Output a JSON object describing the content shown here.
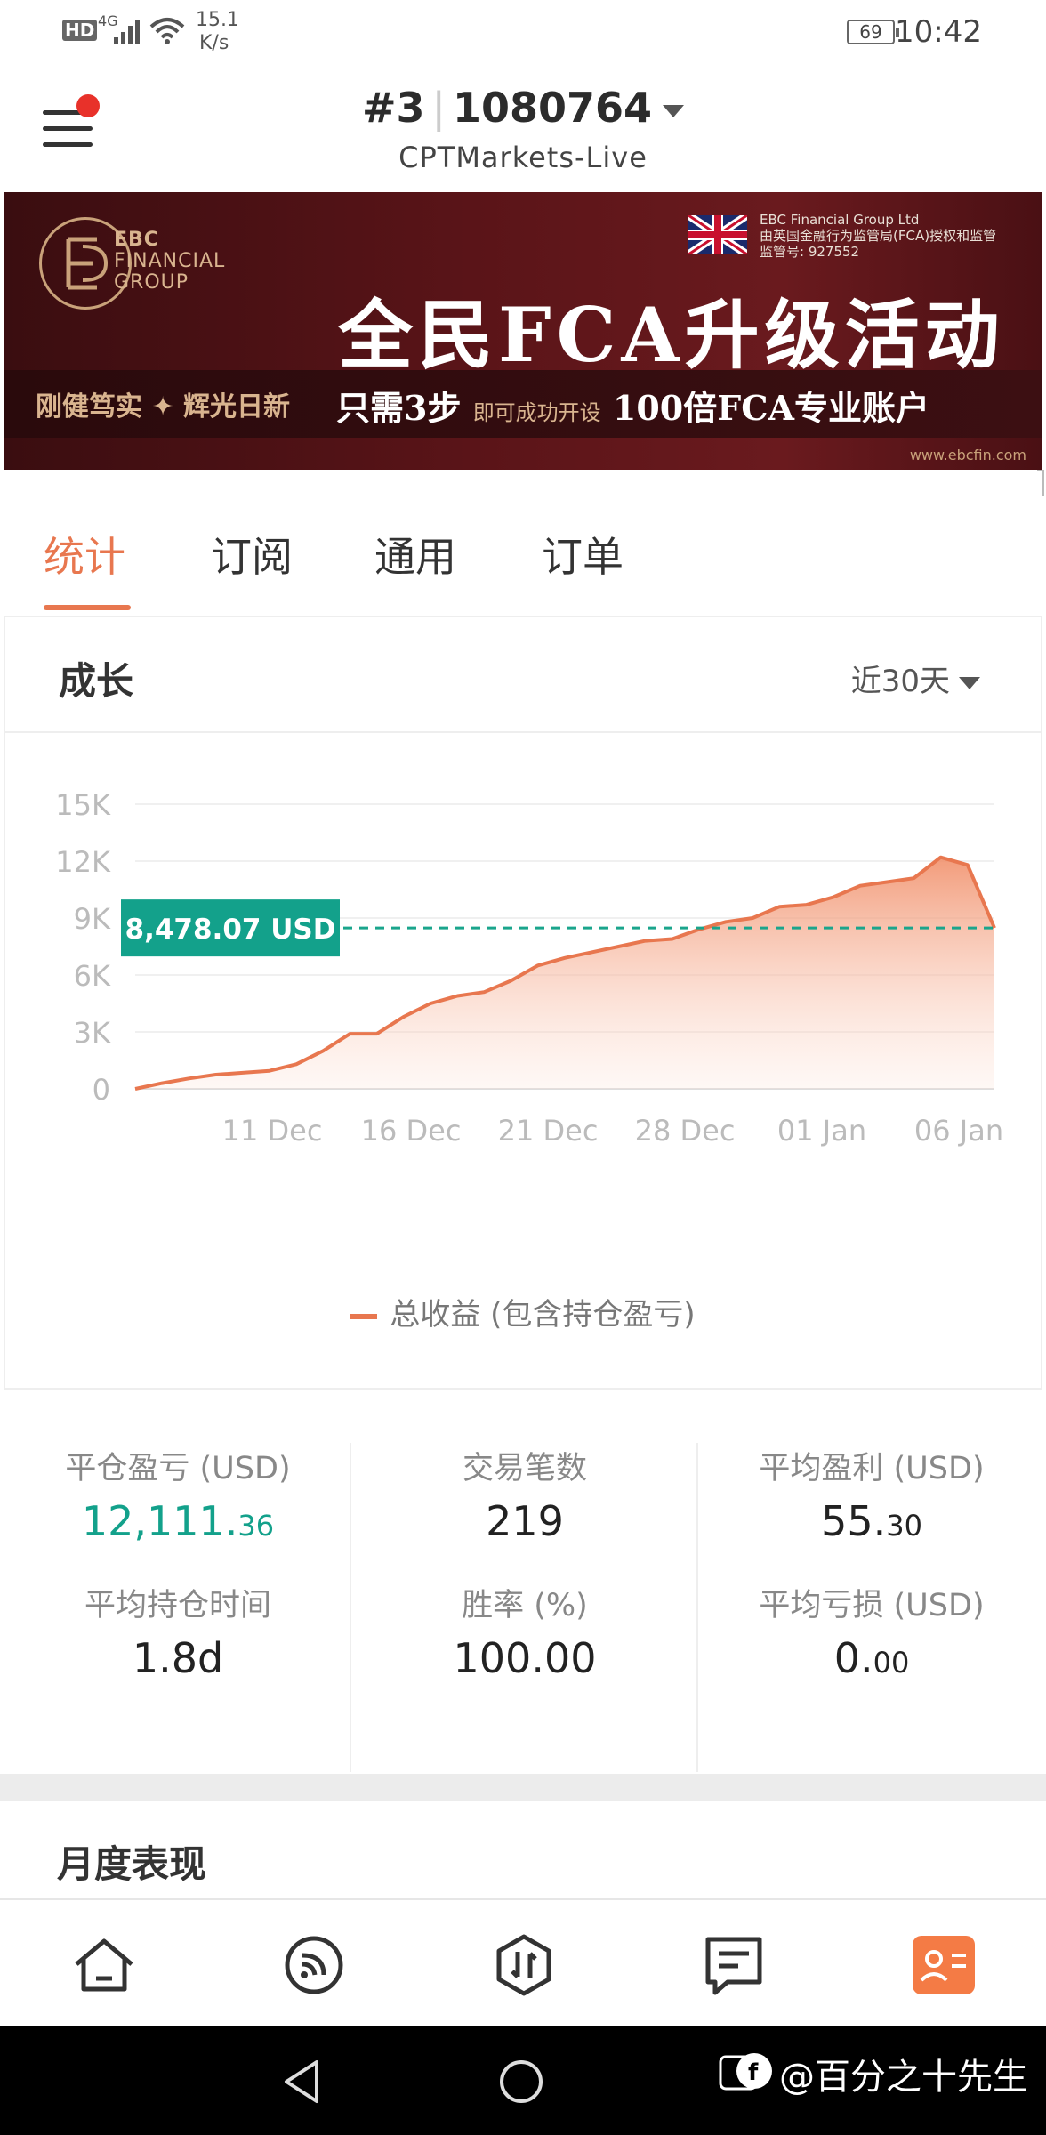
{
  "status_bar": {
    "network": "HD",
    "signal": "4G",
    "speed_value": "15.1",
    "speed_unit": "K/s",
    "battery": "69",
    "time": "10:42"
  },
  "header": {
    "account_index": "#3",
    "account_number": "1080764",
    "server": "CPTMarkets-Live"
  },
  "banner": {
    "company_lines": [
      "EBC",
      "FINANCIAL",
      "GROUP"
    ],
    "regulator_line1": "EBC Financial Group Ltd",
    "regulator_line2": "由英国金融行为监管局(FCA)授权和监管",
    "regulator_line3": "监管号: 927552",
    "headline": "全民FCA升级活动",
    "slogan": "刚健笃实 ✦ 辉光日新",
    "offer_bold1": "只需3步",
    "offer_small": "即可成功开设",
    "offer_bold2": "100倍FCA专业账户",
    "url": "www.ebcfin.com"
  },
  "tabs": [
    {
      "label": "统计",
      "active": true
    },
    {
      "label": "订阅",
      "active": false
    },
    {
      "label": "通用",
      "active": false
    },
    {
      "label": "订单",
      "active": false
    }
  ],
  "growth": {
    "title": "成长",
    "range": "近30天",
    "tooltip": "8,478.07 USD",
    "legend": "总收益 (包含持仓盈亏)"
  },
  "chart_data": {
    "type": "area",
    "y_tick_labels": [
      "15K",
      "12K",
      "9K",
      "6K",
      "3K",
      "0"
    ],
    "x_tick_labels": [
      "11 Dec",
      "16 Dec",
      "21 Dec",
      "28 Dec",
      "01 Jan",
      "06 Jan"
    ],
    "ylim": [
      0,
      15000
    ],
    "series": [
      {
        "name": "总收益 (包含持仓盈亏)",
        "color": "#e8774f",
        "values": [
          0,
          300,
          550,
          750,
          850,
          950,
          1300,
          2000,
          2900,
          2900,
          3800,
          4500,
          4900,
          5100,
          5700,
          6500,
          6900,
          7200,
          7500,
          7800,
          7900,
          8400,
          8800,
          9000,
          9600,
          9700,
          10100,
          10700,
          10900,
          11100,
          12200,
          11800,
          8478.07
        ]
      }
    ],
    "reference_value": 8478.07,
    "grid": true
  },
  "stats": [
    {
      "label": "平仓盈亏 (USD)",
      "int": "12,111.",
      "dec": "36",
      "green": true
    },
    {
      "label": "交易笔数",
      "int": "219",
      "dec": "",
      "green": false
    },
    {
      "label": "平均盈利 (USD)",
      "int": "55.",
      "dec": "30",
      "green": false
    },
    {
      "label": "平均持仓时间",
      "int": "1.8d",
      "dec": "",
      "green": false
    },
    {
      "label": "胜率 (%)",
      "int": "100.00",
      "dec": "",
      "green": false
    },
    {
      "label": "平均亏损 (USD)",
      "int": "0.",
      "dec": "00",
      "green": false
    }
  ],
  "monthly": {
    "title": "月度表现"
  },
  "bottom_nav": [
    "home-icon",
    "signal-feed-icon",
    "trade-icon",
    "messages-icon",
    "profile-card-icon"
  ],
  "watermark": "@百分之十先生",
  "colors": {
    "accent": "#e8774f",
    "green": "#13a18b",
    "banner": "#5a1418"
  }
}
